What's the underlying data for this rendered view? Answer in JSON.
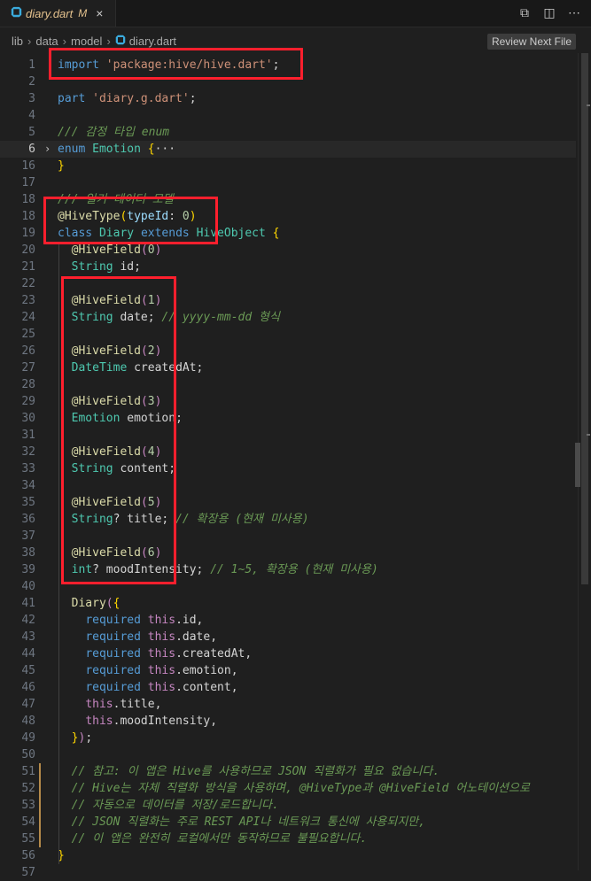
{
  "tab": {
    "filename": "diary.dart",
    "modified": "M",
    "close": "×"
  },
  "actions": [
    "⧉",
    "◫",
    "⋯"
  ],
  "breadcrumb": [
    "lib",
    "data",
    "model",
    "diary.dart"
  ],
  "review_button": "Review Next File",
  "colors": {
    "accent": "#ff1f2d",
    "background": "#1f1f1f"
  },
  "lines": [
    {
      "n": "1",
      "tokens": [
        [
          "kw",
          "import "
        ],
        [
          "str",
          "'package:hive/hive.dart'"
        ],
        [
          "pl",
          ";"
        ]
      ]
    },
    {
      "n": "2",
      "tokens": []
    },
    {
      "n": "3",
      "tokens": [
        [
          "kw",
          "part "
        ],
        [
          "str",
          "'diary.g.dart'"
        ],
        [
          "pl",
          ";"
        ]
      ]
    },
    {
      "n": "4",
      "tokens": []
    },
    {
      "n": "5",
      "tokens": [
        [
          "cm",
          "/// 감정 타입 enum"
        ]
      ]
    },
    {
      "n": "6",
      "tokens": [
        [
          "kw",
          "enum "
        ],
        [
          "ty",
          "Emotion "
        ],
        [
          "pn",
          "{"
        ],
        [
          "pl",
          "···"
        ]
      ],
      "current": true,
      "fold": "›"
    },
    {
      "n": "16",
      "tokens": [
        [
          "pn",
          "}"
        ]
      ]
    },
    {
      "n": "17",
      "tokens": []
    },
    {
      "n": "18",
      "tokens": [
        [
          "cm",
          "/// 일기 데이터 모델"
        ]
      ]
    },
    {
      "n": "18",
      "tokens": [
        [
          "an",
          "@HiveType"
        ],
        [
          "pn",
          "("
        ],
        [
          "pa",
          "typeId"
        ],
        [
          "pl",
          ": "
        ],
        [
          "nm",
          "0"
        ],
        [
          "pn",
          ")"
        ]
      ]
    },
    {
      "n": "19",
      "tokens": [
        [
          "kw",
          "class "
        ],
        [
          "ty",
          "Diary "
        ],
        [
          "kw",
          "extends "
        ],
        [
          "ty",
          "HiveObject "
        ],
        [
          "pn",
          "{"
        ]
      ]
    },
    {
      "n": "20",
      "tokens": [
        [
          "pl",
          "  "
        ],
        [
          "an",
          "@HiveField"
        ],
        [
          "ct",
          "("
        ],
        [
          "nm",
          "0"
        ],
        [
          "ct",
          ")"
        ]
      ]
    },
    {
      "n": "21",
      "tokens": [
        [
          "pl",
          "  "
        ],
        [
          "ty",
          "String "
        ],
        [
          "pl",
          "id;"
        ]
      ]
    },
    {
      "n": "22",
      "tokens": []
    },
    {
      "n": "23",
      "tokens": [
        [
          "pl",
          "  "
        ],
        [
          "an",
          "@HiveField"
        ],
        [
          "ct",
          "("
        ],
        [
          "nm",
          "1"
        ],
        [
          "ct",
          ")"
        ]
      ]
    },
    {
      "n": "24",
      "tokens": [
        [
          "pl",
          "  "
        ],
        [
          "ty",
          "String "
        ],
        [
          "pl",
          "date; "
        ],
        [
          "cm",
          "// yyyy-mm-dd 형식"
        ]
      ]
    },
    {
      "n": "25",
      "tokens": []
    },
    {
      "n": "26",
      "tokens": [
        [
          "pl",
          "  "
        ],
        [
          "an",
          "@HiveField"
        ],
        [
          "ct",
          "("
        ],
        [
          "nm",
          "2"
        ],
        [
          "ct",
          ")"
        ]
      ]
    },
    {
      "n": "27",
      "tokens": [
        [
          "pl",
          "  "
        ],
        [
          "ty",
          "DateTime "
        ],
        [
          "pl",
          "createdAt;"
        ]
      ]
    },
    {
      "n": "28",
      "tokens": []
    },
    {
      "n": "29",
      "tokens": [
        [
          "pl",
          "  "
        ],
        [
          "an",
          "@HiveField"
        ],
        [
          "ct",
          "("
        ],
        [
          "nm",
          "3"
        ],
        [
          "ct",
          ")"
        ]
      ]
    },
    {
      "n": "30",
      "tokens": [
        [
          "pl",
          "  "
        ],
        [
          "ty",
          "Emotion "
        ],
        [
          "pl",
          "emotion;"
        ]
      ]
    },
    {
      "n": "31",
      "tokens": []
    },
    {
      "n": "32",
      "tokens": [
        [
          "pl",
          "  "
        ],
        [
          "an",
          "@HiveField"
        ],
        [
          "ct",
          "("
        ],
        [
          "nm",
          "4"
        ],
        [
          "ct",
          ")"
        ]
      ]
    },
    {
      "n": "33",
      "tokens": [
        [
          "pl",
          "  "
        ],
        [
          "ty",
          "String "
        ],
        [
          "pl",
          "content;"
        ]
      ]
    },
    {
      "n": "34",
      "tokens": []
    },
    {
      "n": "35",
      "tokens": [
        [
          "pl",
          "  "
        ],
        [
          "an",
          "@HiveField"
        ],
        [
          "ct",
          "("
        ],
        [
          "nm",
          "5"
        ],
        [
          "ct",
          ")"
        ]
      ]
    },
    {
      "n": "36",
      "tokens": [
        [
          "pl",
          "  "
        ],
        [
          "ty",
          "String"
        ],
        [
          "pl",
          "? title; "
        ],
        [
          "cm",
          "// 확장용 (현재 미사용)"
        ]
      ]
    },
    {
      "n": "37",
      "tokens": []
    },
    {
      "n": "38",
      "tokens": [
        [
          "pl",
          "  "
        ],
        [
          "an",
          "@HiveField"
        ],
        [
          "ct",
          "("
        ],
        [
          "nm",
          "6"
        ],
        [
          "ct",
          ")"
        ]
      ]
    },
    {
      "n": "39",
      "tokens": [
        [
          "pl",
          "  "
        ],
        [
          "ty",
          "int"
        ],
        [
          "pl",
          "? moodIntensity; "
        ],
        [
          "cm",
          "// 1~5, 확장용 (현재 미사용)"
        ]
      ]
    },
    {
      "n": "40",
      "tokens": []
    },
    {
      "n": "41",
      "tokens": [
        [
          "pl",
          "  "
        ],
        [
          "fn",
          "Diary"
        ],
        [
          "ct",
          "("
        ],
        [
          "pn",
          "{"
        ]
      ]
    },
    {
      "n": "42",
      "tokens": [
        [
          "pl",
          "    "
        ],
        [
          "kw",
          "required "
        ],
        [
          "ct",
          "this"
        ],
        [
          "pl",
          ".id,"
        ]
      ]
    },
    {
      "n": "43",
      "tokens": [
        [
          "pl",
          "    "
        ],
        [
          "kw",
          "required "
        ],
        [
          "ct",
          "this"
        ],
        [
          "pl",
          ".date,"
        ]
      ]
    },
    {
      "n": "44",
      "tokens": [
        [
          "pl",
          "    "
        ],
        [
          "kw",
          "required "
        ],
        [
          "ct",
          "this"
        ],
        [
          "pl",
          ".createdAt,"
        ]
      ]
    },
    {
      "n": "45",
      "tokens": [
        [
          "pl",
          "    "
        ],
        [
          "kw",
          "required "
        ],
        [
          "ct",
          "this"
        ],
        [
          "pl",
          ".emotion,"
        ]
      ]
    },
    {
      "n": "46",
      "tokens": [
        [
          "pl",
          "    "
        ],
        [
          "kw",
          "required "
        ],
        [
          "ct",
          "this"
        ],
        [
          "pl",
          ".content,"
        ]
      ]
    },
    {
      "n": "47",
      "tokens": [
        [
          "pl",
          "    "
        ],
        [
          "ct",
          "this"
        ],
        [
          "pl",
          ".title,"
        ]
      ]
    },
    {
      "n": "48",
      "tokens": [
        [
          "pl",
          "    "
        ],
        [
          "ct",
          "this"
        ],
        [
          "pl",
          ".moodIntensity,"
        ]
      ]
    },
    {
      "n": "49",
      "tokens": [
        [
          "pl",
          "  "
        ],
        [
          "pn",
          "}"
        ],
        [
          "ct",
          ")"
        ],
        [
          "pl",
          ";"
        ]
      ]
    },
    {
      "n": "50",
      "tokens": []
    },
    {
      "n": "51",
      "tokens": [
        [
          "pl",
          "  "
        ],
        [
          "cm",
          "// 참고: 이 앱은 Hive를 사용하므로 JSON 직렬화가 필요 없습니다."
        ]
      ],
      "mod": true
    },
    {
      "n": "52",
      "tokens": [
        [
          "pl",
          "  "
        ],
        [
          "cm",
          "// Hive는 자체 직렬화 방식을 사용하며, @HiveType과 @HiveField 어노테이션으로"
        ]
      ],
      "mod": true
    },
    {
      "n": "53",
      "tokens": [
        [
          "pl",
          "  "
        ],
        [
          "cm",
          "// 자동으로 데이터를 저장/로드합니다."
        ]
      ],
      "mod": true
    },
    {
      "n": "54",
      "tokens": [
        [
          "pl",
          "  "
        ],
        [
          "cm",
          "// JSON 직렬화는 주로 REST API나 네트워크 통신에 사용되지만,"
        ]
      ],
      "mod": true
    },
    {
      "n": "55",
      "tokens": [
        [
          "pl",
          "  "
        ],
        [
          "cm",
          "// 이 앱은 완전히 로컬에서만 동작하므로 불필요합니다."
        ]
      ],
      "mod": true
    },
    {
      "n": "56",
      "tokens": [
        [
          "pn",
          "}"
        ]
      ]
    },
    {
      "n": "57",
      "tokens": []
    }
  ]
}
